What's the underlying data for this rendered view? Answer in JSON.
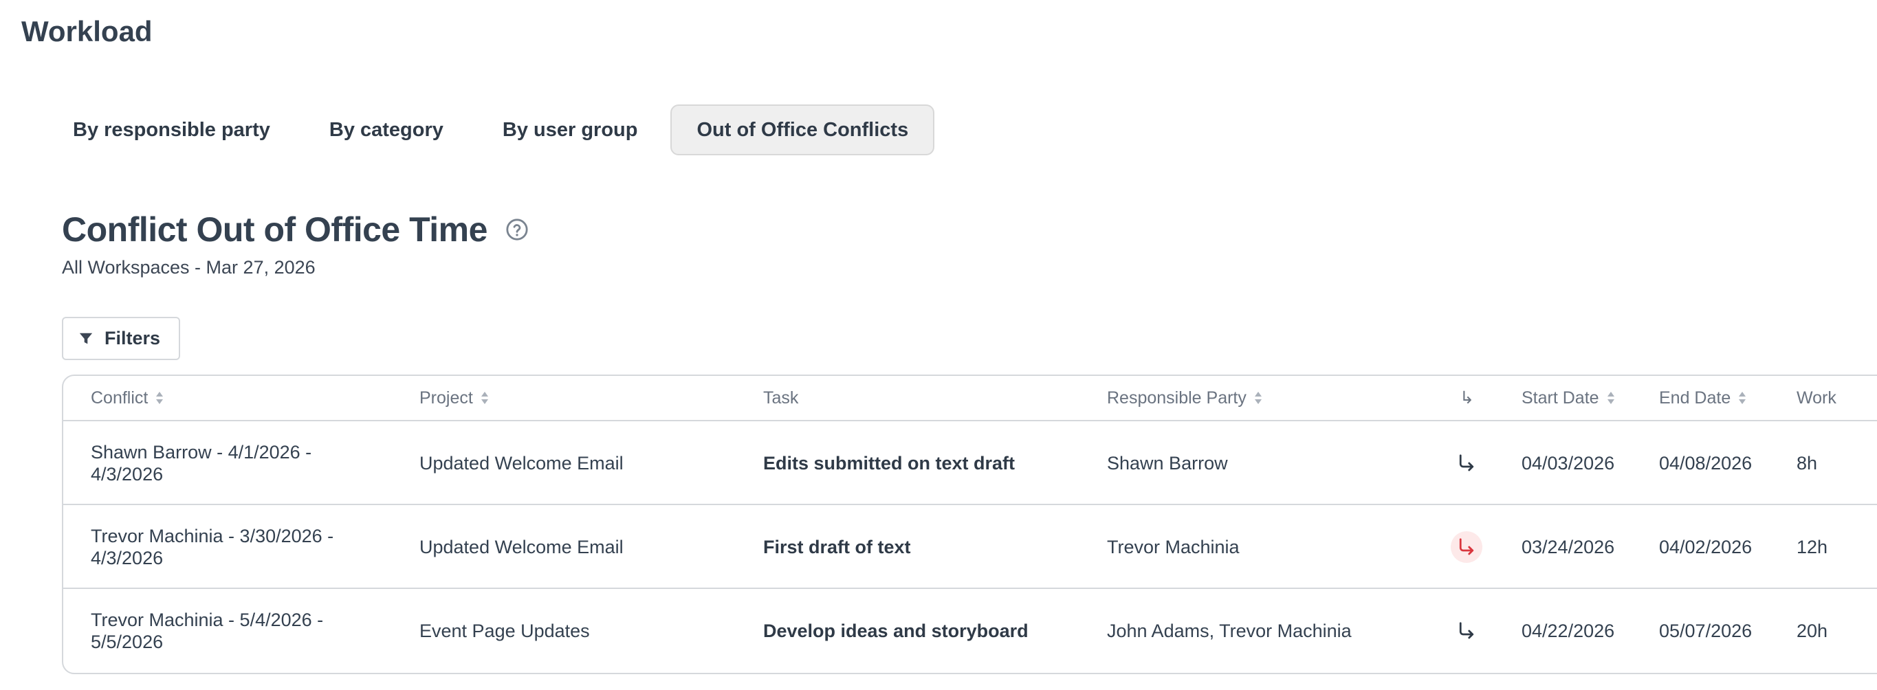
{
  "page": {
    "title": "Workload"
  },
  "tabs": [
    {
      "label": "By responsible party",
      "active": false
    },
    {
      "label": "By category",
      "active": false
    },
    {
      "label": "By user group",
      "active": false
    },
    {
      "label": "Out of Office Conflicts",
      "active": true
    }
  ],
  "section": {
    "title": "Conflict Out of Office Time",
    "subtitle": "All Workspaces - Mar 27, 2026",
    "help_icon": "question-circle-icon"
  },
  "filters": {
    "label": "Filters",
    "icon": "filter-funnel-icon"
  },
  "table": {
    "columns": [
      {
        "label": "Conflict",
        "sortable": true
      },
      {
        "label": "Project",
        "sortable": true
      },
      {
        "label": "Task",
        "sortable": false
      },
      {
        "label": "Responsible Party",
        "sortable": true
      },
      {
        "label": "↳",
        "sortable": false
      },
      {
        "label": "Start Date",
        "sortable": true
      },
      {
        "label": "End Date",
        "sortable": true
      },
      {
        "label": "Work",
        "sortable": false
      }
    ],
    "rows": [
      {
        "conflict": "Shawn Barrow - 4/1/2026 - 4/3/2026",
        "project": "Updated Welcome Email",
        "task": "Edits submitted on text draft",
        "responsible_party": "Shawn Barrow",
        "dependency_conflict": false,
        "start_date": "04/03/2026",
        "end_date": "04/08/2026",
        "work": "8h"
      },
      {
        "conflict": "Trevor Machinia - 3/30/2026 - 4/3/2026",
        "project": "Updated Welcome Email",
        "task": "First draft of text",
        "responsible_party": "Trevor Machinia",
        "dependency_conflict": true,
        "start_date": "03/24/2026",
        "end_date": "04/02/2026",
        "work": "12h"
      },
      {
        "conflict": "Trevor Machinia - 5/4/2026 - 5/5/2026",
        "project": "Event Page Updates",
        "task": "Develop ideas and storyboard",
        "responsible_party": "John Adams, Trevor Machinia",
        "dependency_conflict": false,
        "start_date": "04/22/2026",
        "end_date": "05/07/2026",
        "work": "20h"
      }
    ]
  },
  "colors": {
    "text": "#344150",
    "muted": "#6a7380",
    "border": "#d5d8dc",
    "active_tab_bg": "#efefef",
    "conflict_red": "#d9363e",
    "conflict_bg": "#fde9e9"
  }
}
